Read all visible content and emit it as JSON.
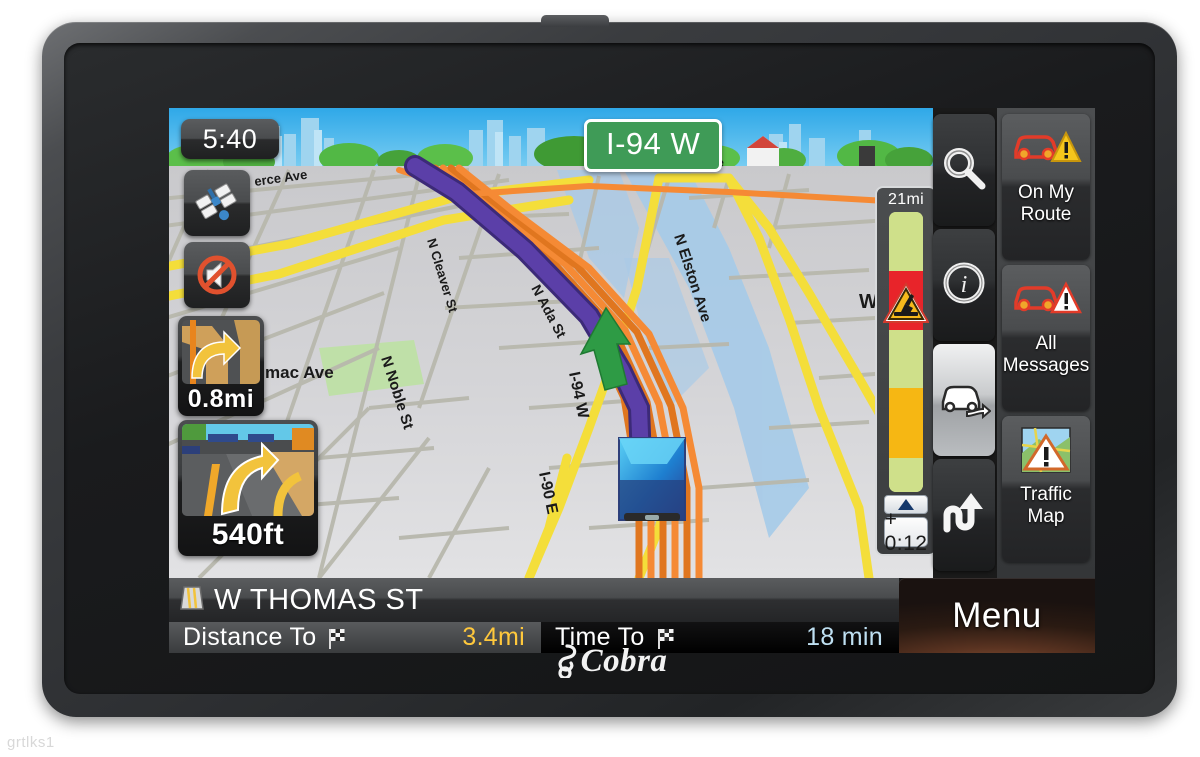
{
  "device": {
    "brand": "Cobra",
    "watermark": "grtlks1"
  },
  "map": {
    "clock": "5:40",
    "route_shield": "I-94 W",
    "street_labels": [
      "erce Ave",
      "N Cleaver St",
      "W North Ave",
      "N Ada St",
      "N Elston Ave",
      "N Noble St",
      "mac Ave",
      "I-94 W",
      "I-90 E",
      "W"
    ],
    "gps_icon": "satellite-icon",
    "mute_icon": "mute-speaker-icon",
    "turn_previews": [
      {
        "name": "next-turn",
        "distance": "0.8mi",
        "icon": "turn-right-ramp-icon"
      },
      {
        "name": "immediate-turn",
        "distance": "540ft",
        "icon": "lane-guidance-icon"
      }
    ]
  },
  "traffic_bar": {
    "range_label": "21mi",
    "delay_label": "+ 0:12",
    "scroll_icon": "triangle-up-icon",
    "incident_icon": "road-work-icon",
    "segments": [
      {
        "color": "#cfe08a",
        "label": "clear",
        "top_pct": 0,
        "height_pct": 21
      },
      {
        "color": "#e8242a",
        "label": "heavy",
        "top_pct": 21,
        "height_pct": 21
      },
      {
        "color": "#cfe08a",
        "label": "clear",
        "top_pct": 42,
        "height_pct": 21
      },
      {
        "color": "#f6b713",
        "label": "slow",
        "top_pct": 63,
        "height_pct": 25
      },
      {
        "color": "#cfe08a",
        "label": "clear",
        "top_pct": 88,
        "height_pct": 12
      }
    ]
  },
  "icon_column": [
    {
      "name": "search-button",
      "icon": "magnifier-icon",
      "active": false
    },
    {
      "name": "info-button",
      "icon": "info-circle-icon",
      "active": false
    },
    {
      "name": "where-am-i-button",
      "icon": "car-arrow-icon",
      "active": true
    },
    {
      "name": "detour-button",
      "icon": "u-turn-icon",
      "active": false
    }
  ],
  "side_column": [
    {
      "name": "on-my-route-button",
      "label": "On My\nRoute",
      "label_line1": "On My",
      "label_line2": "Route",
      "icon": "car-yellow-warning-icon"
    },
    {
      "name": "all-messages-button",
      "label": "All\nMessages",
      "label_line1": "All",
      "label_line2": "Messages",
      "icon": "car-white-warning-icon"
    },
    {
      "name": "traffic-map-button",
      "label": "Traffic\nMap",
      "label_line1": "Traffic",
      "label_line2": "Map",
      "icon": "traffic-map-warning-icon"
    }
  ],
  "status": {
    "current_street": "W THOMAS ST",
    "street_icon": "road-sign-icon",
    "distance_label": "Distance To",
    "distance_value": "3.4mi",
    "time_label": "Time To",
    "time_value": "18 min",
    "flag_icon": "checkered-flag-icon"
  },
  "menu": {
    "label": "Menu"
  },
  "colors": {
    "route": "#5b3fa8",
    "traffic_clear": "#cfe08a",
    "traffic_slow": "#f6b713",
    "traffic_heavy": "#e8242a",
    "highway": "#f58a35",
    "arterial": "#f4de3a",
    "water": "#a8cbe8",
    "sky": "#40b4ee",
    "shield_green": "#3f9b57",
    "distance_accent": "#ffc83c",
    "time_accent": "#bfe0f2"
  }
}
